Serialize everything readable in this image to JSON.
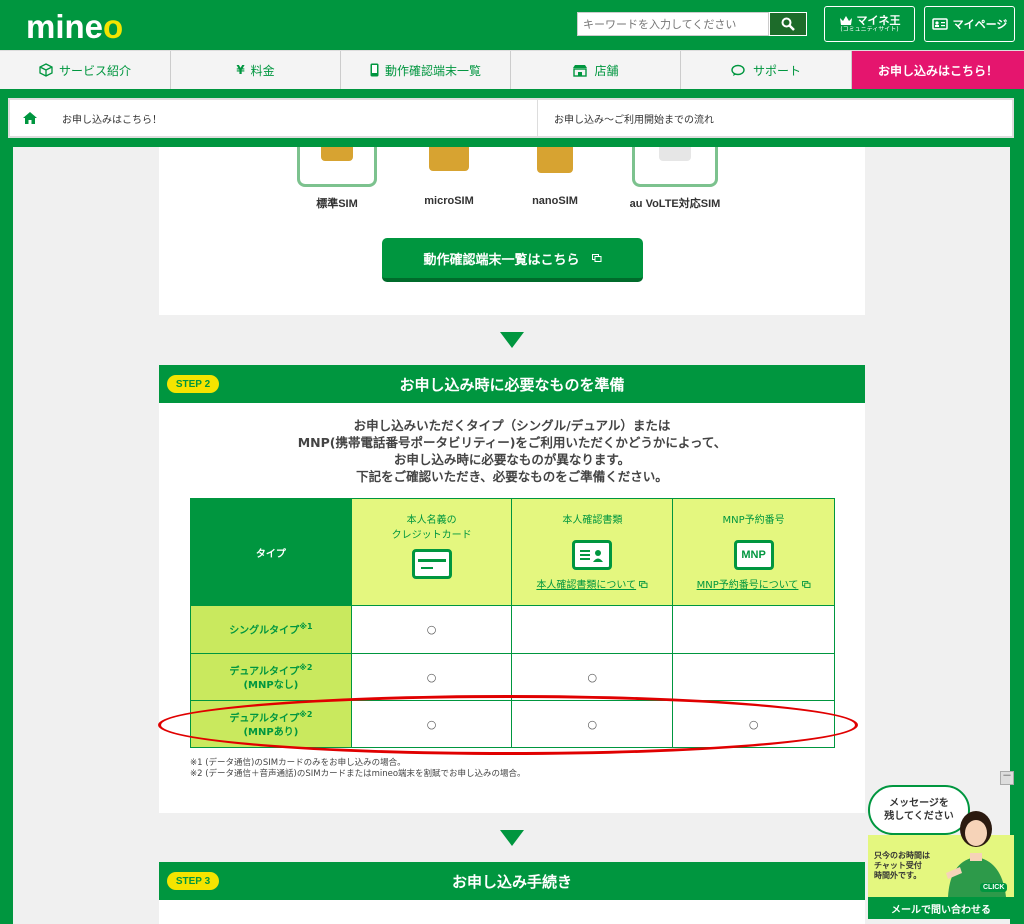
{
  "header": {
    "logo_main": "mine",
    "logo_o": "o",
    "search_placeholder": "キーワードを入力してください",
    "king_label": "マイネ王",
    "king_sub": "(コミュニティサイト)",
    "mypage_label": "マイページ"
  },
  "nav": [
    {
      "label": "サービス紹介",
      "icon": "cube-icon"
    },
    {
      "label": "料金",
      "icon": "yen-icon"
    },
    {
      "label": "動作確認端末一覧",
      "icon": "phone-icon"
    },
    {
      "label": "店舗",
      "icon": "shop-icon"
    },
    {
      "label": "サポート",
      "icon": "chat-icon"
    },
    {
      "label": "お申し込みはこちら！",
      "icon": ""
    }
  ],
  "breadcrumb": {
    "item1": "お申し込みはこちら！",
    "item2": "お申し込み～ご利用開始までの流れ"
  },
  "sims": [
    "標準SIM",
    "microSIM",
    "nanoSIM",
    "au VoLTE対応SIM"
  ],
  "device_button": "動作確認端末一覧はこちら",
  "step2": {
    "badge": "STEP 2",
    "title": "お申し込み時に必要なものを準備",
    "intro": [
      "お申し込みいただくタイプ（シングル/デュアル）または",
      "MNP(携帯電話番号ポータビリティー)をご利用いただくかどうかによって、",
      "お申し込み時に必要なものが異なります。",
      "下記をご確認いただき、必要なものをご準備ください。"
    ]
  },
  "table": {
    "type_header": "タイプ",
    "col1_line1": "本人名義の",
    "col1_line2": "クレジットカード",
    "col2": "本人確認書類",
    "col2_link": "本人確認書類について",
    "col3": "MNP予約番号",
    "col3_link": "MNP予約番号について",
    "mnp_icon_text": "MNP",
    "rows": [
      {
        "name": "シングルタイプ",
        "sup": "※1",
        "sub": "",
        "c1": "○",
        "c2": "",
        "c3": ""
      },
      {
        "name": "デュアルタイプ",
        "sup": "※2",
        "sub": "(MNPなし)",
        "c1": "○",
        "c2": "○",
        "c3": ""
      },
      {
        "name": "デュアルタイプ",
        "sup": "※2",
        "sub": "(MNPあり)",
        "c1": "○",
        "c2": "○",
        "c3": "○"
      }
    ]
  },
  "notes": [
    "※1 (データ通信)のSIMカードのみをお申し込みの場合。",
    "※2 (データ通信＋音声通話)のSIMカードまたはmineo端末を割賦でお申し込みの場合。"
  ],
  "step3": {
    "badge": "STEP 3",
    "title": "お申し込み手続き"
  },
  "chat": {
    "bubble_line1": "メッセージを",
    "bubble_line2": "残してください",
    "msg1": "只今のお時間は",
    "msg2": "チャット受付",
    "msg3": "時間外です。",
    "button": "メールで問い合わせる",
    "click": "CLICK",
    "minus": "－"
  },
  "colors": {
    "brand_green": "#00963f",
    "pink": "#e5156e",
    "yellow_green": "#e4f77f",
    "annotation_red": "#e00000"
  }
}
